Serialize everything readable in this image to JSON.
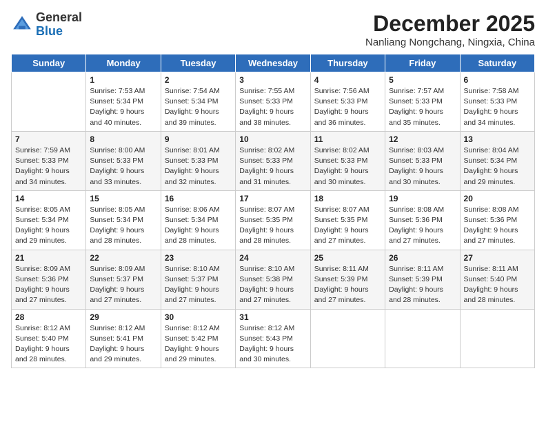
{
  "logo": {
    "general": "General",
    "blue": "Blue"
  },
  "title": {
    "month_year": "December 2025",
    "location": "Nanliang Nongchang, Ningxia, China"
  },
  "weekdays": [
    "Sunday",
    "Monday",
    "Tuesday",
    "Wednesday",
    "Thursday",
    "Friday",
    "Saturday"
  ],
  "weeks": [
    [
      {
        "day": "",
        "info": ""
      },
      {
        "day": "1",
        "info": "Sunrise: 7:53 AM\nSunset: 5:34 PM\nDaylight: 9 hours\nand 40 minutes."
      },
      {
        "day": "2",
        "info": "Sunrise: 7:54 AM\nSunset: 5:34 PM\nDaylight: 9 hours\nand 39 minutes."
      },
      {
        "day": "3",
        "info": "Sunrise: 7:55 AM\nSunset: 5:33 PM\nDaylight: 9 hours\nand 38 minutes."
      },
      {
        "day": "4",
        "info": "Sunrise: 7:56 AM\nSunset: 5:33 PM\nDaylight: 9 hours\nand 36 minutes."
      },
      {
        "day": "5",
        "info": "Sunrise: 7:57 AM\nSunset: 5:33 PM\nDaylight: 9 hours\nand 35 minutes."
      },
      {
        "day": "6",
        "info": "Sunrise: 7:58 AM\nSunset: 5:33 PM\nDaylight: 9 hours\nand 34 minutes."
      }
    ],
    [
      {
        "day": "7",
        "info": "Sunrise: 7:59 AM\nSunset: 5:33 PM\nDaylight: 9 hours\nand 34 minutes."
      },
      {
        "day": "8",
        "info": "Sunrise: 8:00 AM\nSunset: 5:33 PM\nDaylight: 9 hours\nand 33 minutes."
      },
      {
        "day": "9",
        "info": "Sunrise: 8:01 AM\nSunset: 5:33 PM\nDaylight: 9 hours\nand 32 minutes."
      },
      {
        "day": "10",
        "info": "Sunrise: 8:02 AM\nSunset: 5:33 PM\nDaylight: 9 hours\nand 31 minutes."
      },
      {
        "day": "11",
        "info": "Sunrise: 8:02 AM\nSunset: 5:33 PM\nDaylight: 9 hours\nand 30 minutes."
      },
      {
        "day": "12",
        "info": "Sunrise: 8:03 AM\nSunset: 5:33 PM\nDaylight: 9 hours\nand 30 minutes."
      },
      {
        "day": "13",
        "info": "Sunrise: 8:04 AM\nSunset: 5:34 PM\nDaylight: 9 hours\nand 29 minutes."
      }
    ],
    [
      {
        "day": "14",
        "info": "Sunrise: 8:05 AM\nSunset: 5:34 PM\nDaylight: 9 hours\nand 29 minutes."
      },
      {
        "day": "15",
        "info": "Sunrise: 8:05 AM\nSunset: 5:34 PM\nDaylight: 9 hours\nand 28 minutes."
      },
      {
        "day": "16",
        "info": "Sunrise: 8:06 AM\nSunset: 5:34 PM\nDaylight: 9 hours\nand 28 minutes."
      },
      {
        "day": "17",
        "info": "Sunrise: 8:07 AM\nSunset: 5:35 PM\nDaylight: 9 hours\nand 28 minutes."
      },
      {
        "day": "18",
        "info": "Sunrise: 8:07 AM\nSunset: 5:35 PM\nDaylight: 9 hours\nand 27 minutes."
      },
      {
        "day": "19",
        "info": "Sunrise: 8:08 AM\nSunset: 5:36 PM\nDaylight: 9 hours\nand 27 minutes."
      },
      {
        "day": "20",
        "info": "Sunrise: 8:08 AM\nSunset: 5:36 PM\nDaylight: 9 hours\nand 27 minutes."
      }
    ],
    [
      {
        "day": "21",
        "info": "Sunrise: 8:09 AM\nSunset: 5:36 PM\nDaylight: 9 hours\nand 27 minutes."
      },
      {
        "day": "22",
        "info": "Sunrise: 8:09 AM\nSunset: 5:37 PM\nDaylight: 9 hours\nand 27 minutes."
      },
      {
        "day": "23",
        "info": "Sunrise: 8:10 AM\nSunset: 5:37 PM\nDaylight: 9 hours\nand 27 minutes."
      },
      {
        "day": "24",
        "info": "Sunrise: 8:10 AM\nSunset: 5:38 PM\nDaylight: 9 hours\nand 27 minutes."
      },
      {
        "day": "25",
        "info": "Sunrise: 8:11 AM\nSunset: 5:39 PM\nDaylight: 9 hours\nand 27 minutes."
      },
      {
        "day": "26",
        "info": "Sunrise: 8:11 AM\nSunset: 5:39 PM\nDaylight: 9 hours\nand 28 minutes."
      },
      {
        "day": "27",
        "info": "Sunrise: 8:11 AM\nSunset: 5:40 PM\nDaylight: 9 hours\nand 28 minutes."
      }
    ],
    [
      {
        "day": "28",
        "info": "Sunrise: 8:12 AM\nSunset: 5:40 PM\nDaylight: 9 hours\nand 28 minutes."
      },
      {
        "day": "29",
        "info": "Sunrise: 8:12 AM\nSunset: 5:41 PM\nDaylight: 9 hours\nand 29 minutes."
      },
      {
        "day": "30",
        "info": "Sunrise: 8:12 AM\nSunset: 5:42 PM\nDaylight: 9 hours\nand 29 minutes."
      },
      {
        "day": "31",
        "info": "Sunrise: 8:12 AM\nSunset: 5:43 PM\nDaylight: 9 hours\nand 30 minutes."
      },
      {
        "day": "",
        "info": ""
      },
      {
        "day": "",
        "info": ""
      },
      {
        "day": "",
        "info": ""
      }
    ]
  ]
}
